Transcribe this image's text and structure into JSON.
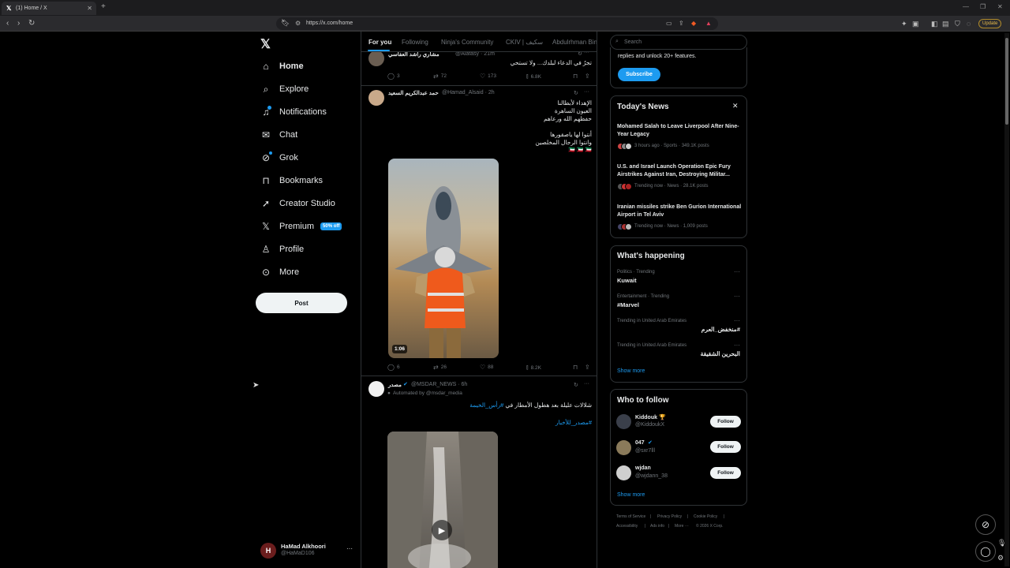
{
  "browser": {
    "tab_title": "(1) Home / X",
    "url": "https://x.com/home",
    "update_label": "Update"
  },
  "nav": {
    "items": [
      {
        "label": "Home",
        "icon": "home-icon"
      },
      {
        "label": "Explore",
        "icon": "search-icon"
      },
      {
        "label": "Notifications",
        "icon": "bell-icon"
      },
      {
        "label": "Chat",
        "icon": "mail-icon"
      },
      {
        "label": "Grok",
        "icon": "grok-icon"
      },
      {
        "label": "Bookmarks",
        "icon": "bookmark-icon"
      },
      {
        "label": "Creator Studio",
        "icon": "rocket-icon"
      },
      {
        "label": "Premium",
        "icon": "x-logo-icon"
      },
      {
        "label": "Profile",
        "icon": "person-icon"
      },
      {
        "label": "More",
        "icon": "more-circle-icon"
      }
    ],
    "premium_badge": "50% off",
    "post_label": "Post",
    "account_name": "HaMad Alkhoori",
    "account_handle": "@HaMaD106"
  },
  "timeline": {
    "tabs": [
      "For you",
      "Following",
      "Ninja's Community",
      "CKIV | سكيف",
      "Abdulrhman Bin"
    ],
    "post0": {
      "name": "مشاري راشد العفاسي",
      "handle": "@Alafasy · 21m",
      "text": "تجرُ في الدعاء لبلدك... ولا تستحي",
      "replies": "3",
      "reposts": "72",
      "likes": "173",
      "views": "6.8K"
    },
    "post1": {
      "name": "حمد عبدالكريم السعيد",
      "handle": "@Hamad_Alsaid · 2h",
      "lines": [
        "الإهداء لأبطالنا",
        "العيون الساهرة",
        "حفظهم الله ورعاهم",
        "",
        "أنتوا لها ياصقورها",
        "وانتوا الرجال المخلصين",
        "🇰🇼 🇰🇼 🇰🇼"
      ],
      "video_duration": "1:06",
      "replies": "6",
      "reposts": "26",
      "likes": "88",
      "views": "8.2K"
    },
    "post2": {
      "name": "مصدر",
      "handle": "@MSDAR_NEWS · 6h",
      "automated": "Automated by @msdar_media",
      "text_main": "شلالات عليلة بعد هطول الأمطار في",
      "hashtag1": "#رأس_الخيمة",
      "hashtag2": "#مصدر_للأخبار"
    }
  },
  "sidebar": {
    "search_placeholder": "Search",
    "premium_text": "replies and unlock 20+ features.",
    "subscribe_label": "Subscribe",
    "news_title": "Today's News",
    "news": [
      {
        "headline": "Mohamed Salah to Leave Liverpool After Nine-Year Legacy",
        "meta": "3 hours ago · Sports · 349.1K posts"
      },
      {
        "headline": "U.S. and Israel Launch Operation Epic Fury Airstrikes Against Iran, Destroying Militar...",
        "meta": "Trending now · News · 28.1K posts"
      },
      {
        "headline": "Iranian missiles strike Ben Gurion International Airport in Tel Aviv",
        "meta": "Trending now · News · 1,009 posts"
      }
    ],
    "happening_title": "What's happening",
    "trends": [
      {
        "context": "Politics · Trending",
        "name": "Kuwait"
      },
      {
        "context": "Entertainment · Trending",
        "name": "#Marvel"
      },
      {
        "context": "Trending in United Arab Emirates",
        "name": "#منخفض_العرم"
      },
      {
        "context": "Trending in United Arab Emirates",
        "name": "البحرين الشقيقة"
      }
    ],
    "show_more": "Show more",
    "follow_title": "Who to follow",
    "follow": [
      {
        "name": "Kiddouk 🏆",
        "handle": "@KiddoukX"
      },
      {
        "name": "047",
        "handle": "@sxr7lll"
      },
      {
        "name": "wjdan",
        "handle": "@wjdann_38"
      }
    ],
    "follow_label": "Follow",
    "footer": [
      "Terms of Service",
      "|",
      "Privacy Policy",
      "|",
      "Cookie Policy",
      "|",
      "Accessibility",
      "|",
      "Ads info",
      "|",
      "More ···",
      "© 2026 X Corp."
    ]
  }
}
